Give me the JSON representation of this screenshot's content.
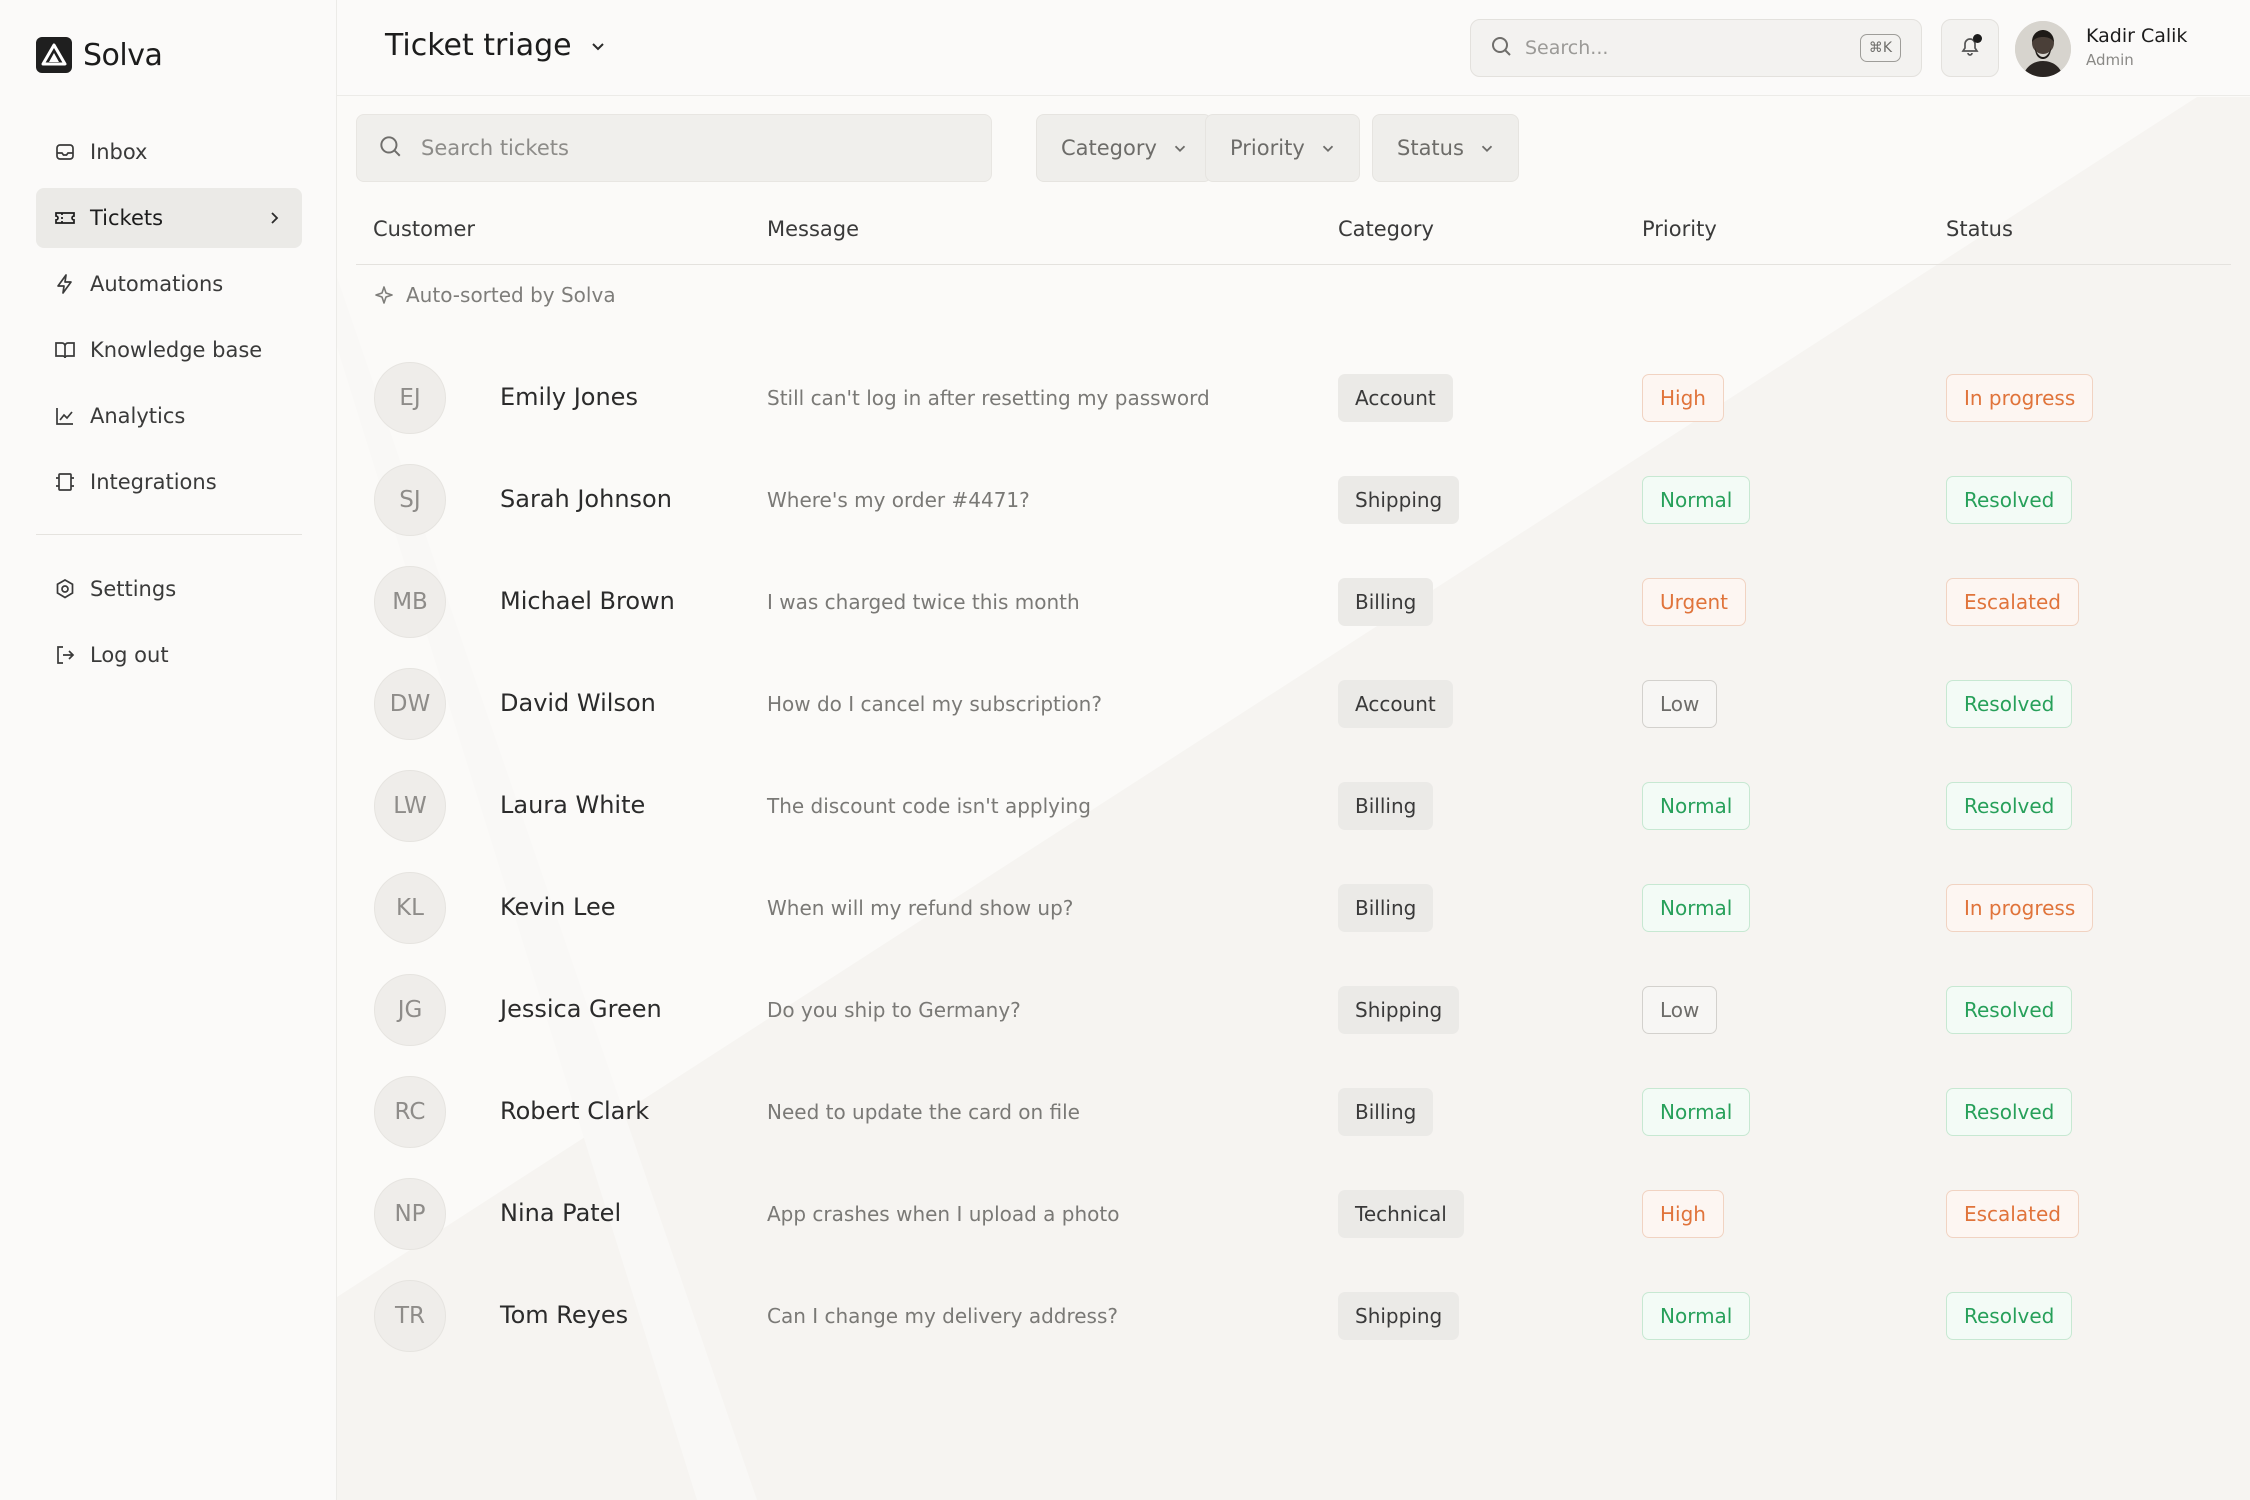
{
  "brand": {
    "name": "Solva"
  },
  "sidebar": {
    "items": [
      {
        "label": "Inbox",
        "icon": "inbox-icon",
        "active": false
      },
      {
        "label": "Tickets",
        "icon": "ticket-icon",
        "active": true
      },
      {
        "label": "Automations",
        "icon": "lightning-icon",
        "active": false
      },
      {
        "label": "Knowledge base",
        "icon": "book-icon",
        "active": false
      },
      {
        "label": "Analytics",
        "icon": "chart-icon",
        "active": false
      },
      {
        "label": "Integrations",
        "icon": "integration-icon",
        "active": false
      }
    ],
    "bottom_items": [
      {
        "label": "Settings",
        "icon": "gear-icon"
      },
      {
        "label": "Log out",
        "icon": "logout-icon"
      }
    ]
  },
  "header": {
    "title": "Ticket triage",
    "search_placeholder": "Search...",
    "search_shortcut": "⌘K",
    "user": {
      "name": "Kadir Calik",
      "role": "Admin"
    }
  },
  "filters": {
    "search_placeholder": "Search tickets",
    "category": "Category",
    "priority": "Priority",
    "status": "Status"
  },
  "table": {
    "columns": {
      "customer": "Customer",
      "message": "Message",
      "category": "Category",
      "priority": "Priority",
      "status": "Status"
    },
    "group_label": "Auto-sorted by Solva",
    "rows": [
      {
        "initials": "EJ",
        "customer": "Emily Jones",
        "message": "Still can't log in after resetting my password",
        "category": "Account",
        "priority": "High",
        "status": "In progress"
      },
      {
        "initials": "SJ",
        "customer": "Sarah Johnson",
        "message": "Where's my order #4471?",
        "category": "Shipping",
        "priority": "Normal",
        "status": "Resolved"
      },
      {
        "initials": "MB",
        "customer": "Michael Brown",
        "message": "I was charged twice this month",
        "category": "Billing",
        "priority": "Urgent",
        "status": "Escalated"
      },
      {
        "initials": "DW",
        "customer": "David Wilson",
        "message": "How do I cancel my subscription?",
        "category": "Account",
        "priority": "Low",
        "status": "Resolved"
      },
      {
        "initials": "LW",
        "customer": "Laura White",
        "message": "The discount code isn't applying",
        "category": "Billing",
        "priority": "Normal",
        "status": "Resolved"
      },
      {
        "initials": "KL",
        "customer": "Kevin Lee",
        "message": "When will my refund show up?",
        "category": "Billing",
        "priority": "Normal",
        "status": "In progress"
      },
      {
        "initials": "JG",
        "customer": "Jessica Green",
        "message": "Do you ship to Germany?",
        "category": "Shipping",
        "priority": "Low",
        "status": "Resolved"
      },
      {
        "initials": "RC",
        "customer": "Robert Clark",
        "message": "Need to update the card on file",
        "category": "Billing",
        "priority": "Normal",
        "status": "Resolved"
      },
      {
        "initials": "NP",
        "customer": "Nina Patel",
        "message": "App crashes when I upload a photo",
        "category": "Technical",
        "priority": "High",
        "status": "Escalated"
      },
      {
        "initials": "TR",
        "customer": "Tom Reyes",
        "message": "Can I change my delivery address?",
        "category": "Shipping",
        "priority": "Normal",
        "status": "Resolved"
      }
    ]
  },
  "colors": {
    "warning_text": "#e0743b",
    "success_text": "#27a05a",
    "neutral_text": "#6d6c69",
    "active_nav_bg": "#ebeae7"
  }
}
